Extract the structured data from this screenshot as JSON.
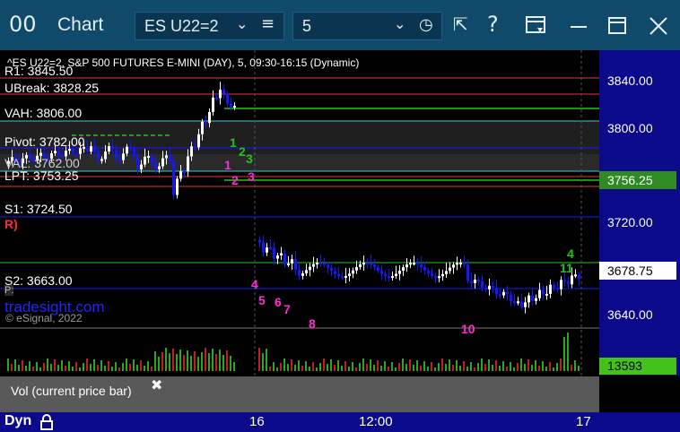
{
  "titlebar": {
    "window_icon": "00",
    "title": "Chart",
    "symbol": "ES U22=2",
    "interval": "5",
    "icons": [
      "symbol-dropdown-chevron-icon",
      "menu-lines-icon",
      "interval-dropdown-chevron-icon",
      "clock-icon",
      "pin-icon",
      "help-icon",
      "template-icon",
      "minimize-icon",
      "maximize-icon",
      "close-icon"
    ]
  },
  "chart": {
    "legend": "^ES U22=2, S&P 500 FUTURES E-MINI (DAY), 5, 09:30-16:15 (Dynamic)",
    "levels": {
      "r1": "R1: 3845.50",
      "ubreak": "UBreak: 3828.25",
      "vah": "VAH: 3806.00",
      "pivot": "Pivot: 3782.00",
      "val": "VAL: 3762.00",
      "lpt": "LPT: 3753.25",
      "s1": "S1: 3724.50",
      "s2": "S2: 3663.00",
      "r_marker": "R)",
      "p_marker": "P:"
    },
    "price_axis": [
      "3840.00",
      "3800.00",
      "3720.00",
      "3640.00"
    ],
    "last_price_tag": "3756.25",
    "current_price_tag": "3678.75",
    "volume_tag": "13593",
    "watermark": "tradesight.com",
    "copyright": "© eSignal, 2022",
    "time_axis": [
      "16",
      "12:00",
      "17"
    ],
    "annotations": [
      "1",
      "2",
      "3",
      "4",
      "5",
      "6",
      "7",
      "8",
      "10",
      "11",
      "1",
      "2",
      "3",
      "4"
    ],
    "colors": {
      "up_bar": "#ffffff",
      "down_bar": "#1515ff",
      "resistance": "#e53939",
      "vah": "#30d0d0",
      "pivot": "#1a1aff",
      "target": "#27c21b",
      "axis_bg": "#0a0a8a"
    }
  },
  "volume_panel": {
    "label": "Vol (current price bar)",
    "close_icon": "close-icon"
  },
  "bottom_bar": {
    "mode": "Dyn",
    "lock_icon": "lock-icon"
  }
}
